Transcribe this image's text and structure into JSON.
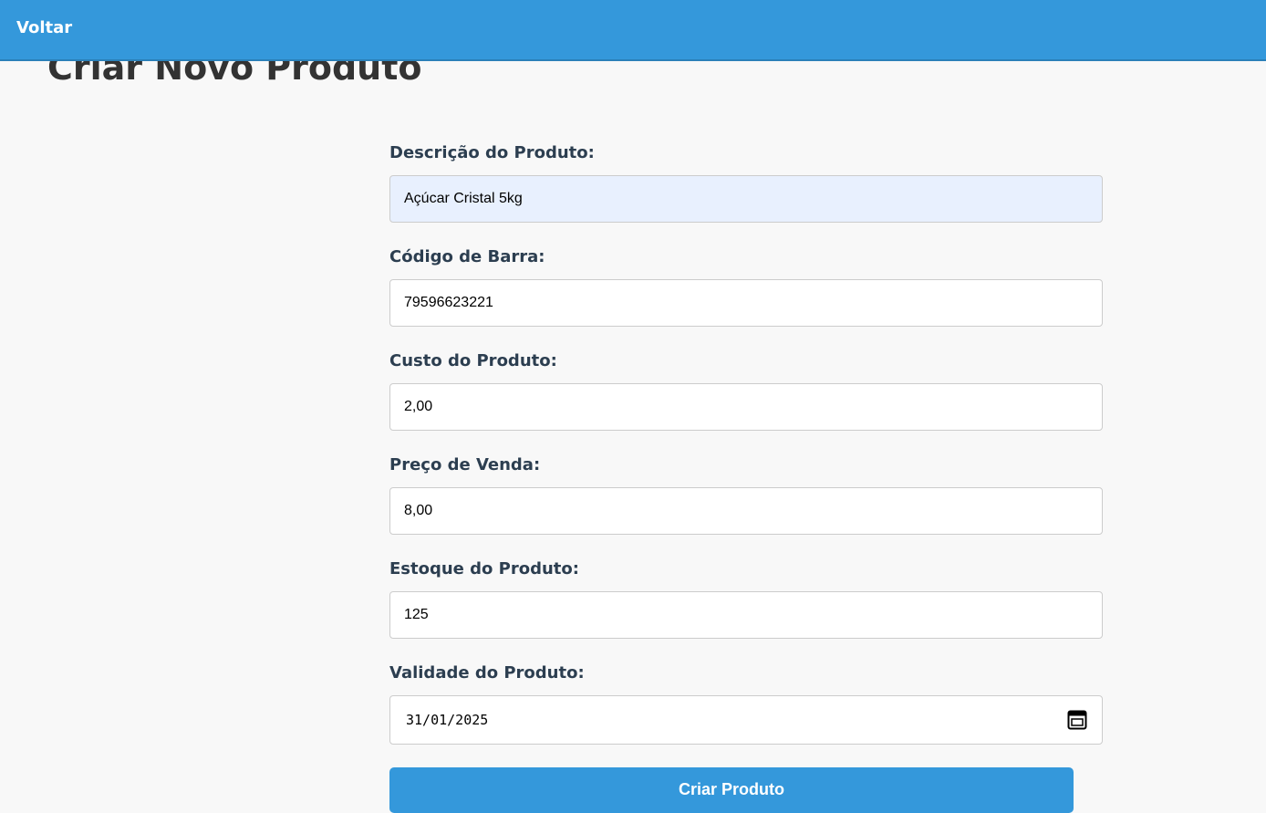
{
  "header": {
    "back_label": "Voltar"
  },
  "page": {
    "title": "Criar Novo Produto"
  },
  "form": {
    "description": {
      "label": "Descrição do Produto:",
      "value": "Açúcar Cristal 5kg"
    },
    "barcode": {
      "label": "Código de Barra:",
      "value": "79596623221"
    },
    "cost": {
      "label": "Custo do Produto:",
      "value": "2,00"
    },
    "price": {
      "label": "Preço de Venda:",
      "value": "8,00"
    },
    "stock": {
      "label": "Estoque do Produto:",
      "value": "125"
    },
    "expiry": {
      "label": "Validade do Produto:",
      "value": "31/01/2025"
    },
    "submit_label": "Criar Produto"
  },
  "colors": {
    "primary": "#3498db",
    "autofill_bg": "#e8f0fe",
    "label": "#2c3e50",
    "page_bg": "#f8f8f8"
  },
  "icons": {
    "date_picker": "calendar-icon"
  }
}
